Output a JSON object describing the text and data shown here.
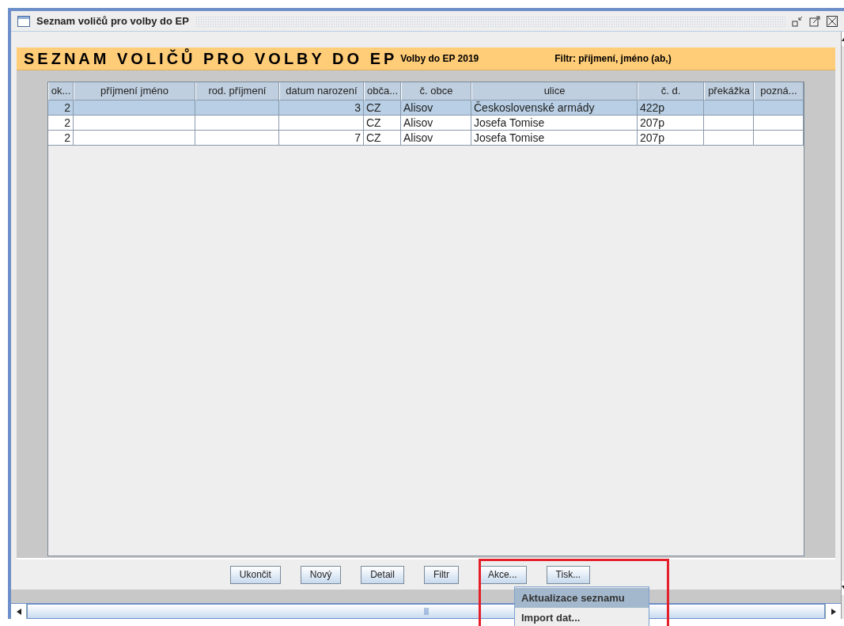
{
  "window": {
    "title": "Seznam voličů pro volby do EP"
  },
  "header": {
    "title": "SEZNAM VOLIČŮ PRO VOLBY DO EP",
    "subtitle": "Volby do EP 2019",
    "filter": "Filtr: příjmení, jméno (ab,)"
  },
  "table": {
    "columns": [
      "ok...",
      "příjmení jméno",
      "rod. příjmení",
      "datum narození",
      "obča...",
      "č. obce",
      "ulice",
      "č. d.",
      "překážka",
      "pozná..."
    ],
    "rows": [
      {
        "selected": true,
        "cells": [
          "2",
          "",
          "",
          "3",
          "CZ",
          "Alisov",
          "Československé armády",
          "422p",
          "",
          ""
        ]
      },
      {
        "selected": false,
        "cells": [
          "2",
          "",
          "",
          "",
          "CZ",
          "Alisov",
          "Josefa Tomise",
          "207p",
          "",
          ""
        ]
      },
      {
        "selected": false,
        "cells": [
          "2",
          "",
          "",
          "7",
          "CZ",
          "Alisov",
          "Josefa Tomise",
          "207p",
          "",
          ""
        ]
      }
    ]
  },
  "buttons": [
    "Ukončit",
    "Nový",
    "Detail",
    "Filtr",
    "Akce...",
    "Tisk..."
  ],
  "popup_menu": [
    {
      "label": "Aktualizace seznamu",
      "selected": true
    },
    {
      "label": "Import dat...",
      "selected": false
    }
  ]
}
